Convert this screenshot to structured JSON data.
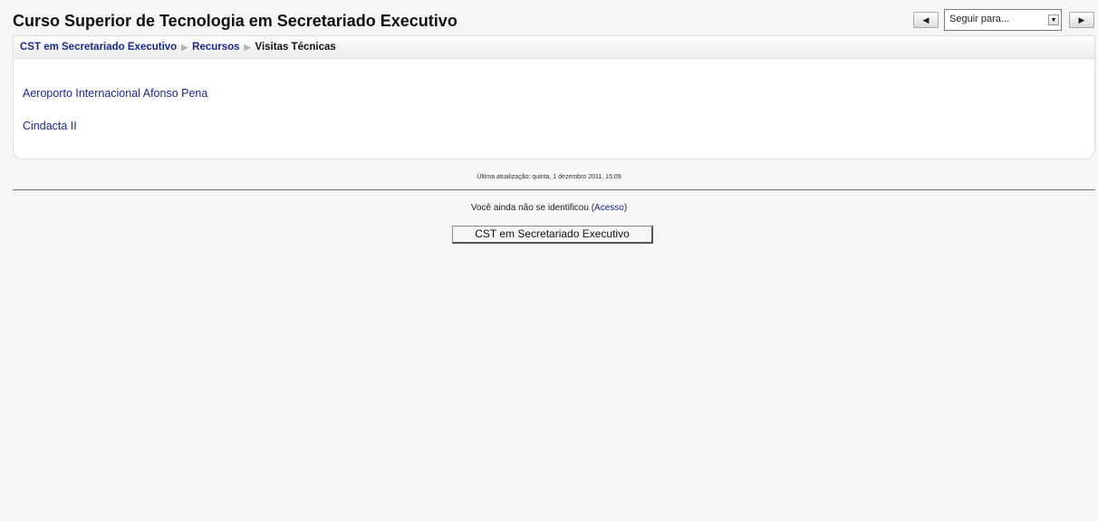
{
  "header": {
    "title": "Curso Superior de Tecnologia em Secretariado Executivo",
    "jump": {
      "prev_icon": "triangle-left-icon",
      "next_icon": "triangle-right-icon",
      "select_value": "Seguir para..."
    }
  },
  "breadcrumb": {
    "items": [
      {
        "label": "CST em Secretariado Executivo",
        "link": true
      },
      {
        "label": "Recursos",
        "link": true
      },
      {
        "label": "Visitas Técnicas",
        "link": false
      }
    ],
    "separator": "▶"
  },
  "resources": [
    {
      "label": "Aeroporto Internacional Afonso Pena"
    },
    {
      "label": "Cindacta II"
    }
  ],
  "footer": {
    "last_updated": "Última atualização: quinta, 1 dezembro 2011, 15:09",
    "login_text": "Você ainda não se identificou",
    "login_link_label": "Acesso",
    "course_button_label": "CST em Secretariado Executivo"
  },
  "colors": {
    "link": "#1a2a8a",
    "background": "#f6f6f6"
  }
}
